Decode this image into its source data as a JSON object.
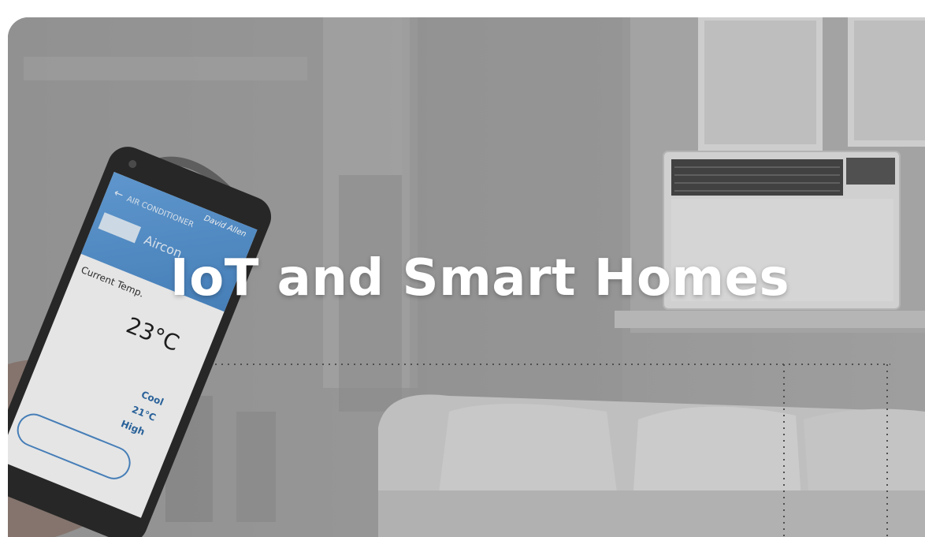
{
  "hero": {
    "title": "IoT and Smart Homes"
  },
  "phone": {
    "app_header": "AIR CONDITIONER",
    "device_name": "Aircon",
    "owner_label": "David Allen",
    "current_temp_label": "Current Temp.",
    "current_temp_value": "23°C",
    "mode": "Cool",
    "set_temp": "21°C",
    "fan_speed": "High"
  },
  "icons": {
    "wifi": "wifi-icon",
    "back": "back-arrow-icon"
  },
  "colors": {
    "overlay": "#8e8e8e",
    "title": "#ffffff",
    "phone_screen_header": "#4a8fd0",
    "phone_text": "#1f5f9e"
  }
}
